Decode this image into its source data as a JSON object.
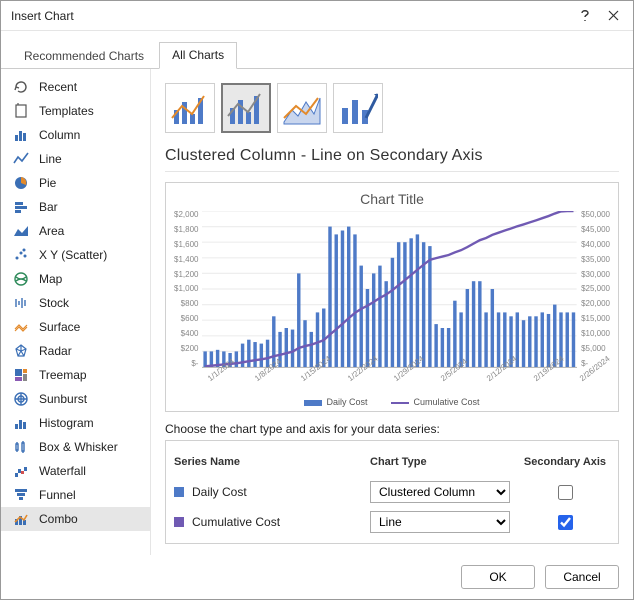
{
  "title": "Insert Chart",
  "tabs": {
    "recommended": "Recommended Charts",
    "all": "All Charts",
    "active": "all"
  },
  "sidebar": {
    "items": [
      {
        "label": "Recent"
      },
      {
        "label": "Templates"
      },
      {
        "label": "Column"
      },
      {
        "label": "Line"
      },
      {
        "label": "Pie"
      },
      {
        "label": "Bar"
      },
      {
        "label": "Area"
      },
      {
        "label": "X Y (Scatter)"
      },
      {
        "label": "Map"
      },
      {
        "label": "Stock"
      },
      {
        "label": "Surface"
      },
      {
        "label": "Radar"
      },
      {
        "label": "Treemap"
      },
      {
        "label": "Sunburst"
      },
      {
        "label": "Histogram"
      },
      {
        "label": "Box & Whisker"
      },
      {
        "label": "Waterfall"
      },
      {
        "label": "Funnel"
      },
      {
        "label": "Combo"
      }
    ],
    "selected_index": 18
  },
  "main": {
    "heading": "Clustered Column - Line on Secondary Axis",
    "chart_title": "Chart Title",
    "legend": {
      "s1": "Daily Cost",
      "s2": "Cumulative Cost"
    },
    "series_config_label": "Choose the chart type and axis for your data series:",
    "headers": {
      "name": "Series Name",
      "type": "Chart Type",
      "axis": "Secondary Axis"
    },
    "series": [
      {
        "name": "Daily Cost",
        "type": "Clustered Column",
        "secondary": false
      },
      {
        "name": "Cumulative Cost",
        "type": "Line",
        "secondary": true
      }
    ]
  },
  "footer": {
    "ok": "OK",
    "cancel": "Cancel"
  },
  "chart_data": {
    "type": "combo",
    "title": "Chart Title",
    "xlabel": "",
    "ylabel": "",
    "y2label": "",
    "ylim": [
      0,
      2000
    ],
    "y2lim": [
      0,
      50000
    ],
    "categories": [
      "1/1/2024",
      "1/8/2024",
      "1/15/2024",
      "1/22/2024",
      "1/29/2024",
      "2/5/2024",
      "2/12/2024",
      "2/19/2024",
      "2/26/2024"
    ],
    "x_days": 60,
    "series": [
      {
        "name": "Daily Cost",
        "type": "bar",
        "axis": "primary",
        "values": [
          200,
          200,
          220,
          200,
          180,
          200,
          300,
          350,
          320,
          300,
          350,
          650,
          450,
          500,
          480,
          1200,
          600,
          450,
          700,
          750,
          1800,
          1700,
          1750,
          1800,
          1700,
          1300,
          1000,
          1200,
          1300,
          1100,
          1400,
          1600,
          1600,
          1650,
          1700,
          1600,
          1550,
          550,
          500,
          500,
          850,
          700,
          1000,
          1100,
          1100,
          700,
          1000,
          700,
          700,
          650,
          700,
          600,
          650,
          650,
          700,
          680,
          800,
          700,
          700,
          700
        ]
      },
      {
        "name": "Cumulative Cost",
        "type": "line",
        "axis": "secondary",
        "values": [
          200,
          400,
          620,
          820,
          1000,
          1200,
          1500,
          1850,
          2170,
          2470,
          2820,
          3470,
          3920,
          4420,
          4900,
          6100,
          6700,
          7150,
          7850,
          8600,
          10400,
          12100,
          13850,
          15650,
          17350,
          18650,
          19650,
          20850,
          22150,
          23250,
          24650,
          26250,
          27850,
          29500,
          31200,
          32800,
          34350,
          34900,
          35400,
          35900,
          36750,
          37450,
          38450,
          39550,
          40650,
          41350,
          42350,
          43050,
          43750,
          44400,
          45100,
          45700,
          46350,
          47000,
          47700,
          48380,
          49180,
          49880,
          50580,
          51280
        ]
      }
    ],
    "y_ticks": [
      "$2,000",
      "$1,800",
      "$1,600",
      "$1,400",
      "$1,200",
      "$1,000",
      "$800",
      "$600",
      "$400",
      "$200",
      "$-"
    ],
    "y2_ticks": [
      "$50,000",
      "$45,000",
      "$40,000",
      "$35,000",
      "$30,000",
      "$25,000",
      "$20,000",
      "$15,000",
      "$10,000",
      "$5,000",
      "$-"
    ]
  }
}
